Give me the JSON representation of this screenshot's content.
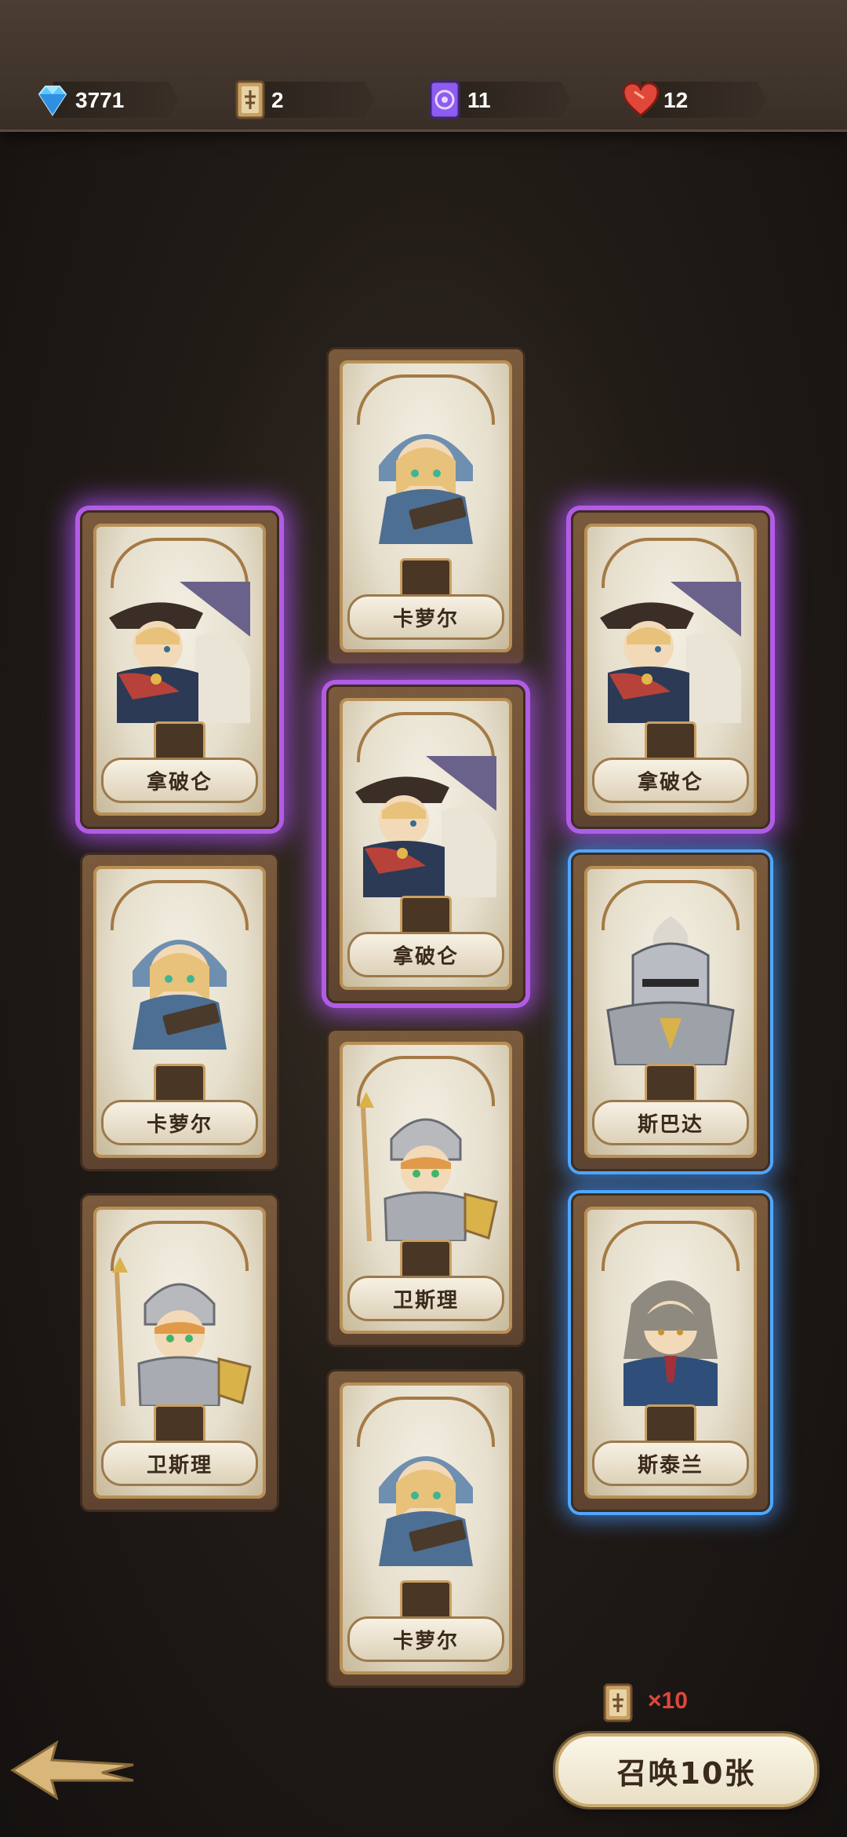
{
  "resources": [
    {
      "icon": "diamond-icon",
      "value": "3771",
      "color": "#5cc6ff"
    },
    {
      "icon": "summon-card-icon",
      "value": "2",
      "color": "#c9a064"
    },
    {
      "icon": "purple-scroll-icon",
      "value": "11",
      "color": "#8d5cf0"
    },
    {
      "icon": "heart-icon",
      "value": "12",
      "color": "#e0473a"
    }
  ],
  "cards": [
    {
      "name": "卡萝尔",
      "rarity": "normal",
      "hero": "carol"
    },
    {
      "name": "拿破仑",
      "rarity": "epic",
      "hero": "napoleon"
    },
    {
      "name": "拿破仑",
      "rarity": "epic",
      "hero": "napoleon"
    },
    {
      "name": "拿破仑",
      "rarity": "epic",
      "hero": "napoleon"
    },
    {
      "name": "卡萝尔",
      "rarity": "normal",
      "hero": "carol"
    },
    {
      "name": "斯巴达",
      "rarity": "rare",
      "hero": "sparta"
    },
    {
      "name": "卫斯理",
      "rarity": "normal",
      "hero": "wesley"
    },
    {
      "name": "卫斯理",
      "rarity": "normal",
      "hero": "wesley"
    },
    {
      "name": "斯泰兰",
      "rarity": "rare",
      "hero": "stellan"
    },
    {
      "name": "卡萝尔",
      "rarity": "normal",
      "hero": "carol"
    }
  ],
  "summon": {
    "cost_icon": "summon-card-icon",
    "cost_text": "×10",
    "button_label": "召唤10张"
  },
  "navigation": {
    "back_icon": "back-arrow-icon"
  }
}
